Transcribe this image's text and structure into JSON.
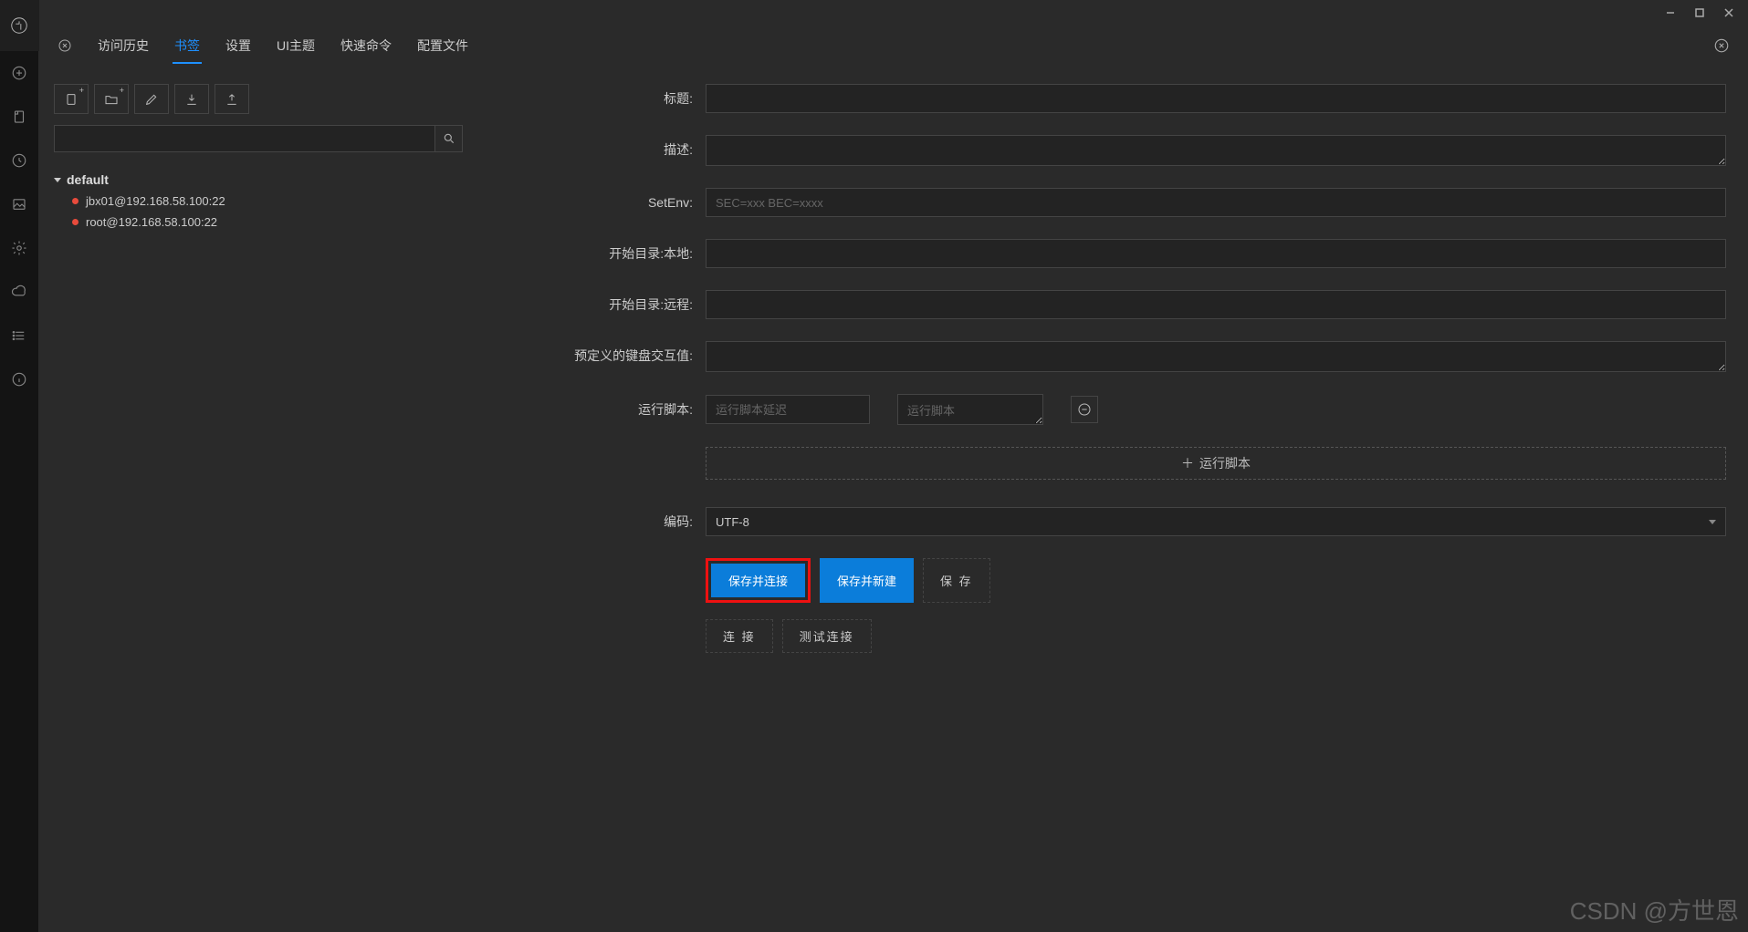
{
  "rail": {
    "items": [
      "add",
      "doc",
      "history",
      "image",
      "settings",
      "cloud",
      "list",
      "info"
    ]
  },
  "tabs": {
    "items": [
      {
        "label": "访问历史"
      },
      {
        "label": "书签"
      },
      {
        "label": "设置"
      },
      {
        "label": "UI主题"
      },
      {
        "label": "快速命令"
      },
      {
        "label": "配置文件"
      }
    ],
    "active_index": 1
  },
  "bookmarks": {
    "group": "default",
    "items": [
      {
        "label": "jbx01@192.168.58.100:22"
      },
      {
        "label": "root@192.168.58.100:22"
      }
    ]
  },
  "form": {
    "title_label": "标题:",
    "desc_label": "描述:",
    "setenv_label": "SetEnv:",
    "setenv_placeholder": "SEC=xxx BEC=xxxx",
    "start_local_label": "开始目录:本地:",
    "start_remote_label": "开始目录:远程:",
    "keyboard_label": "预定义的键盘交互值:",
    "script_label": "运行脚本:",
    "script_delay_placeholder": "运行脚本延迟",
    "script_text_placeholder": "运行脚本",
    "add_script_btn": "运行脚本",
    "encoding_label": "编码:",
    "encoding_value": "UTF-8"
  },
  "buttons": {
    "save_connect": "保存并连接",
    "save_new": "保存并新建",
    "save": "保 存",
    "connect": "连 接",
    "test": "测试连接"
  },
  "watermark": "CSDN @方世恩"
}
